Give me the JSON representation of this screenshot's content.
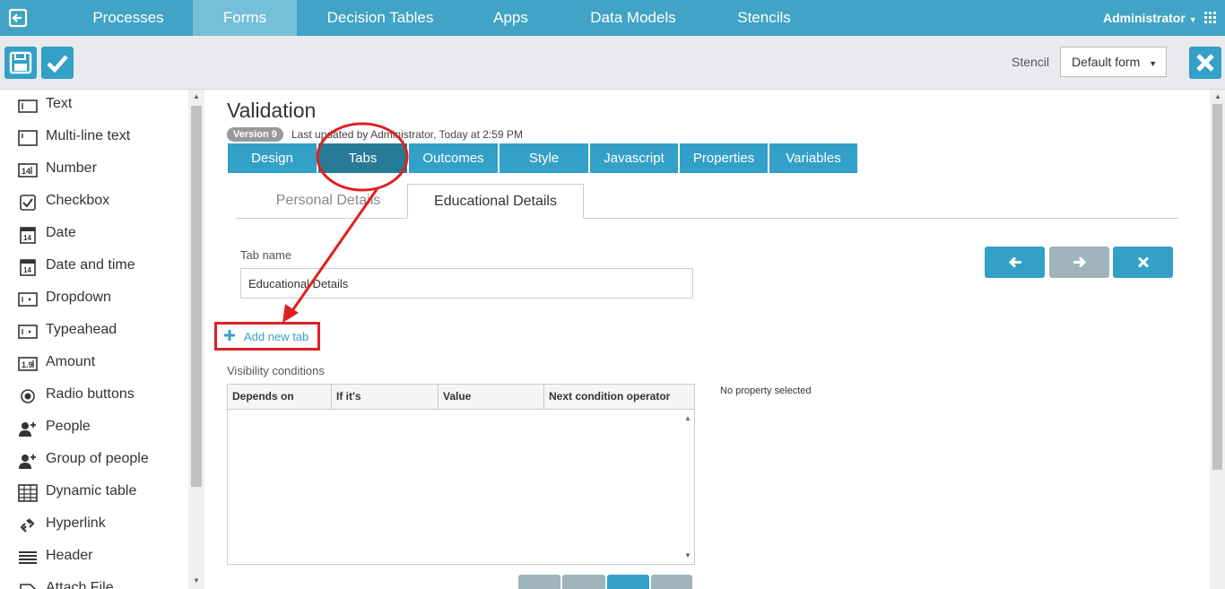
{
  "nav": {
    "items": [
      "Processes",
      "Forms",
      "Decision Tables",
      "Apps",
      "Data Models",
      "Stencils"
    ],
    "active": "Forms",
    "user": "Administrator"
  },
  "toolbar": {
    "stencil_label": "Stencil",
    "stencil_value": "Default form"
  },
  "palette": {
    "items": [
      {
        "label": "Text",
        "icon": "text-icon"
      },
      {
        "label": "Multi-line text",
        "icon": "multiline-text-icon"
      },
      {
        "label": "Number",
        "icon": "number-icon"
      },
      {
        "label": "Checkbox",
        "icon": "checkbox-icon"
      },
      {
        "label": "Date",
        "icon": "date-icon"
      },
      {
        "label": "Date and time",
        "icon": "date-time-icon"
      },
      {
        "label": "Dropdown",
        "icon": "dropdown-icon"
      },
      {
        "label": "Typeahead",
        "icon": "typeahead-icon"
      },
      {
        "label": "Amount",
        "icon": "amount-icon"
      },
      {
        "label": "Radio buttons",
        "icon": "radio-icon"
      },
      {
        "label": "People",
        "icon": "person-icon"
      },
      {
        "label": "Group of people",
        "icon": "group-icon"
      },
      {
        "label": "Dynamic table",
        "icon": "table-icon"
      },
      {
        "label": "Hyperlink",
        "icon": "link-icon"
      },
      {
        "label": "Header",
        "icon": "header-icon"
      },
      {
        "label": "Attach File",
        "icon": "attach-icon"
      }
    ]
  },
  "form": {
    "title": "Validation",
    "version": "Version 9",
    "updated": "Last updated by Administrator, Today at 2:59 PM"
  },
  "editor_tabs": [
    "Design",
    "Tabs",
    "Outcomes",
    "Style",
    "Javascript",
    "Properties",
    "Variables"
  ],
  "active_editor_tab": "Tabs",
  "form_tabs": [
    "Personal Details",
    "Educational Details"
  ],
  "active_form_tab": "Educational Details",
  "tab_name": {
    "label": "Tab name",
    "value": "Educational Details"
  },
  "add_tab_label": "Add new tab",
  "visibility": {
    "label": "Visibility conditions",
    "columns": [
      "Depends on",
      "If it's",
      "Value",
      "Next condition operator"
    ],
    "no_property": "No property selected"
  },
  "colors": {
    "nav": "#41a3c5",
    "button": "#33a0c7",
    "annotation": "#e02020"
  }
}
